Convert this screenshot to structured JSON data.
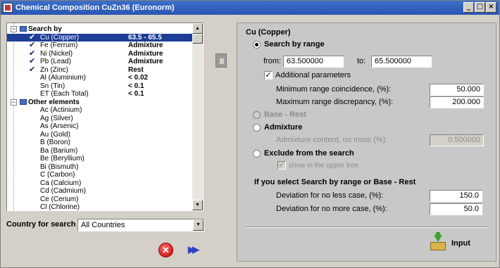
{
  "window": {
    "title": "Chemical Composition CuZn36 (Euronorm)"
  },
  "tree": {
    "rows": [
      {
        "type": "group",
        "label": "Search by",
        "expanded": true
      },
      {
        "type": "item",
        "checked": true,
        "label": "Cu (Copper)",
        "value": "63.5 - 65.5",
        "selected": true
      },
      {
        "type": "item",
        "checked": true,
        "label": "Fe (Ferrum)",
        "value": "Admixture"
      },
      {
        "type": "item",
        "checked": true,
        "label": "Ni (Nickel)",
        "value": "Admixture"
      },
      {
        "type": "item",
        "checked": true,
        "label": "Pb (Lead)",
        "value": "Admixture"
      },
      {
        "type": "item",
        "checked": true,
        "label": "Zn (Zinc)",
        "value": "Rest"
      },
      {
        "type": "item",
        "checked": false,
        "label": "Al (Aluminium)",
        "value": "< 0.02"
      },
      {
        "type": "item",
        "checked": false,
        "label": "Sn (Tin)",
        "value": "< 0.1"
      },
      {
        "type": "item",
        "checked": false,
        "label": "ET (Each Total)",
        "value": "< 0.1"
      },
      {
        "type": "group",
        "label": "Other elements",
        "expanded": true
      },
      {
        "type": "item",
        "checked": false,
        "label": "Ac (Actinium)",
        "value": ""
      },
      {
        "type": "item",
        "checked": false,
        "label": "Ag (Silver)",
        "value": ""
      },
      {
        "type": "item",
        "checked": false,
        "label": "As (Arsenic)",
        "value": ""
      },
      {
        "type": "item",
        "checked": false,
        "label": "Au (Gold)",
        "value": ""
      },
      {
        "type": "item",
        "checked": false,
        "label": "B (Boron)",
        "value": ""
      },
      {
        "type": "item",
        "checked": false,
        "label": "Ba (Barium)",
        "value": ""
      },
      {
        "type": "item",
        "checked": false,
        "label": "Be (Beryllium)",
        "value": ""
      },
      {
        "type": "item",
        "checked": false,
        "label": "Bi (Bismuth)",
        "value": ""
      },
      {
        "type": "item",
        "checked": false,
        "label": "C (Carbon)",
        "value": ""
      },
      {
        "type": "item",
        "checked": false,
        "label": "Ca (Calcium)",
        "value": ""
      },
      {
        "type": "item",
        "checked": false,
        "label": "Cd (Cadmium)",
        "value": ""
      },
      {
        "type": "item",
        "checked": false,
        "label": "Ce (Cerium)",
        "value": ""
      },
      {
        "type": "item",
        "checked": false,
        "label": "Cl (Chlorine)",
        "value": ""
      }
    ]
  },
  "country": {
    "label": "Country for search",
    "value": "All Countries"
  },
  "panel": {
    "header": "Cu (Copper)",
    "search_by_range_label": "Search by range",
    "from_label": "from:",
    "from_value": "63.500000",
    "to_label": "to:",
    "to_value": "65.500000",
    "additional_params_label": "Additional parameters",
    "min_coincidence_label": "Minimum range coincidence, (%):",
    "min_coincidence_value": "50.000",
    "max_discrepancy_label": "Maximum range discrepancy, (%):",
    "max_discrepancy_value": "200.000",
    "base_rest_label": "Base - Rest",
    "admixture_label": "Admixture",
    "admixture_content_label": "Admixture content, no more (%):",
    "admixture_content_value": "0.500000",
    "exclude_label": "Exclude from the search",
    "show_upper_tree_label": "show in the upper tree",
    "deviation_header": "If you select Search by range or Base - Rest",
    "dev_no_less_label": "Deviation for no less case, (%):",
    "dev_no_less_value": "150.0",
    "dev_no_more_label": "Deviation for no more case, (%):",
    "dev_no_more_value": "50.0"
  },
  "input_button": {
    "label": "Input"
  },
  "icons": {
    "app": "app-icon",
    "cancel": "cancel-icon",
    "forward": "fast-forward-icon",
    "copy": "clipboard-icon",
    "input": "input-box-icon"
  }
}
